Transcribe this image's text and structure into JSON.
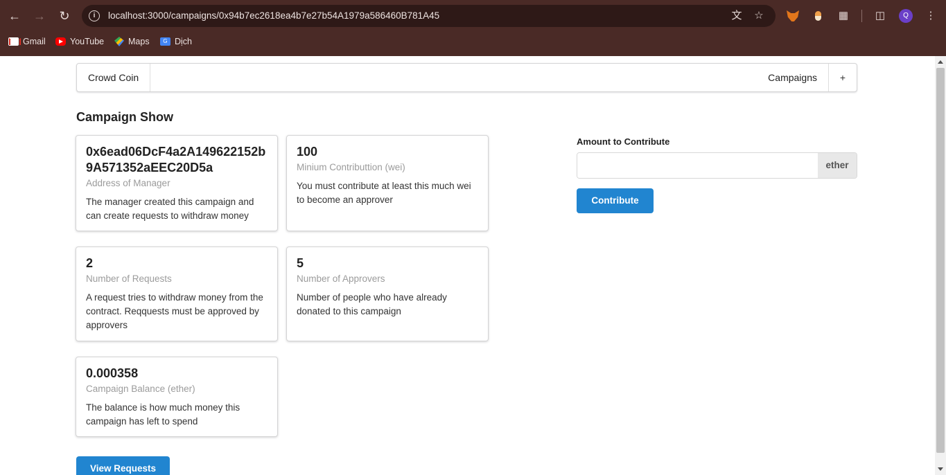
{
  "browser": {
    "url_host": "localhost",
    "url_rest": ":3000/campaigns/0x94b7ec2618ea4b7e27b54A1979a586460B781A45",
    "profile_initial": "Q",
    "bookmarks": [
      {
        "label": "Gmail",
        "icon": "gmail-icon"
      },
      {
        "label": "YouTube",
        "icon": "youtube-icon"
      },
      {
        "label": "Maps",
        "icon": "maps-icon"
      },
      {
        "label": "Dịch",
        "icon": "translate-icon"
      }
    ]
  },
  "menu": {
    "brand": "Crowd Coin",
    "campaigns": "Campaigns",
    "add": "+"
  },
  "page": {
    "title": "Campaign Show"
  },
  "cards": [
    {
      "header": "0x6ead06DcF4a2A149622152b9A571352aEEC20D5a",
      "meta": "Address of Manager",
      "description": "The manager created this campaign and can create requests to withdraw money"
    },
    {
      "header": "100",
      "meta": "Minium Contributtion (wei)",
      "description": "You must contribute at least this much wei to become an approver"
    },
    {
      "header": "2",
      "meta": "Number of Requests",
      "description": "A request tries to withdraw money from the contract. Reqquests must be approved by approvers"
    },
    {
      "header": "5",
      "meta": "Number of Approvers",
      "description": "Number of people who have already donated to this campaign"
    },
    {
      "header": "0.000358",
      "meta": "Campaign Balance (ether)",
      "description": "The balance is how much money this campaign has left to spend"
    }
  ],
  "contribute_form": {
    "label": "Amount to Contribute",
    "value": "",
    "unit": "ether",
    "button": "Contribute"
  },
  "actions": {
    "view_requests": "View Requests"
  },
  "colors": {
    "primary": "#2185d0",
    "chrome": "#4a2a26"
  }
}
